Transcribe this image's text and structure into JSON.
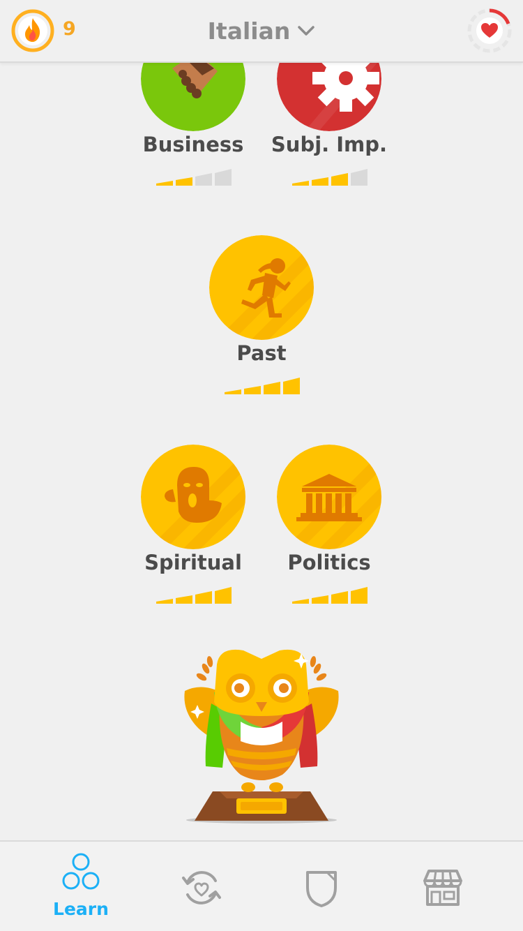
{
  "header": {
    "streak_count": "9",
    "streak_icon": "flame-icon",
    "language_label": "Italian",
    "language_chevron_icon": "chevron-down-icon",
    "health_icon": "heart-icon"
  },
  "skills": [
    {
      "name": "Business",
      "icon": "handshake-icon",
      "color": "#78c800",
      "strength_bars": 2
    },
    {
      "name": "Subj. Imp.",
      "icon": "gear-icon",
      "color": "#d33131",
      "strength_bars": 3
    },
    {
      "name": "Past",
      "icon": "runner-icon",
      "color": "#ffc200",
      "strength_bars": 4
    },
    {
      "name": "Spiritual",
      "icon": "ghost-icon",
      "color": "#ffc200",
      "strength_bars": 4
    },
    {
      "name": "Politics",
      "icon": "government-building-icon",
      "color": "#ffc200",
      "strength_bars": 4
    }
  ],
  "trophy": {
    "icon": "owl-trophy-icon"
  },
  "bottom_nav": {
    "tabs": [
      {
        "label": "Learn",
        "icon": "learn-circles-icon",
        "active": true
      },
      {
        "label": "",
        "icon": "practice-heart-icon",
        "active": false
      },
      {
        "label": "",
        "icon": "league-shield-icon",
        "active": false
      },
      {
        "label": "",
        "icon": "shop-icon",
        "active": false
      }
    ]
  },
  "colors": {
    "accent_blue": "#1cb0f6",
    "gold": "#ffc200",
    "strength_on": "#ffc200",
    "strength_off": "#d9d9d9",
    "text_dark": "#4b4b4b",
    "text_grey": "#8c8c8c"
  }
}
